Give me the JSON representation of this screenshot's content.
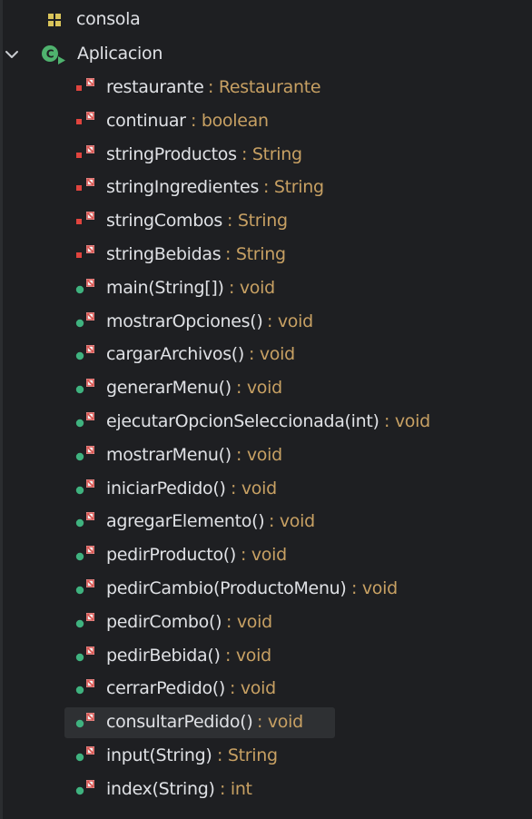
{
  "tree": {
    "package": {
      "label": "consola",
      "icon": "package-icon"
    },
    "class": {
      "label": "Aplicacion",
      "icon": "class-icon",
      "expanded": true
    },
    "fields": [
      {
        "name": "restaurante",
        "type": ": Restaurante"
      },
      {
        "name": "continuar",
        "type": ": boolean"
      },
      {
        "name": "stringProductos",
        "type": ": String"
      },
      {
        "name": "stringIngredientes",
        "type": ": String"
      },
      {
        "name": "stringCombos",
        "type": ": String"
      },
      {
        "name": "stringBebidas",
        "type": ": String"
      }
    ],
    "methods": [
      {
        "name": "main(String[])",
        "type": ": void"
      },
      {
        "name": "mostrarOpciones()",
        "type": ": void"
      },
      {
        "name": "cargarArchivos()",
        "type": ": void"
      },
      {
        "name": "generarMenu()",
        "type": ": void"
      },
      {
        "name": "ejecutarOpcionSeleccionada(int)",
        "type": ": void"
      },
      {
        "name": "mostrarMenu()",
        "type": ": void"
      },
      {
        "name": "iniciarPedido()",
        "type": ": void"
      },
      {
        "name": "agregarElemento()",
        "type": ": void"
      },
      {
        "name": "pedirProducto()",
        "type": ": void"
      },
      {
        "name": "pedirCambio(ProductoMenu)",
        "type": ": void"
      },
      {
        "name": "pedirCombo()",
        "type": ": void"
      },
      {
        "name": "pedirBebida()",
        "type": ": void"
      },
      {
        "name": "cerrarPedido()",
        "type": ": void"
      },
      {
        "name": "consultarPedido()",
        "type": ": void",
        "selected": true
      },
      {
        "name": "input(String)",
        "type": ": String"
      },
      {
        "name": "index(String)",
        "type": ": int"
      }
    ]
  },
  "colors": {
    "background": "#1e1f22",
    "text": "#dfe1e5",
    "type_text": "#c7a063",
    "private_dot": "#e0443e",
    "public_dot": "#3fb27f",
    "static_badge": "#d9534f",
    "class_icon": "#4fb26e",
    "selection": "#2e3033"
  }
}
